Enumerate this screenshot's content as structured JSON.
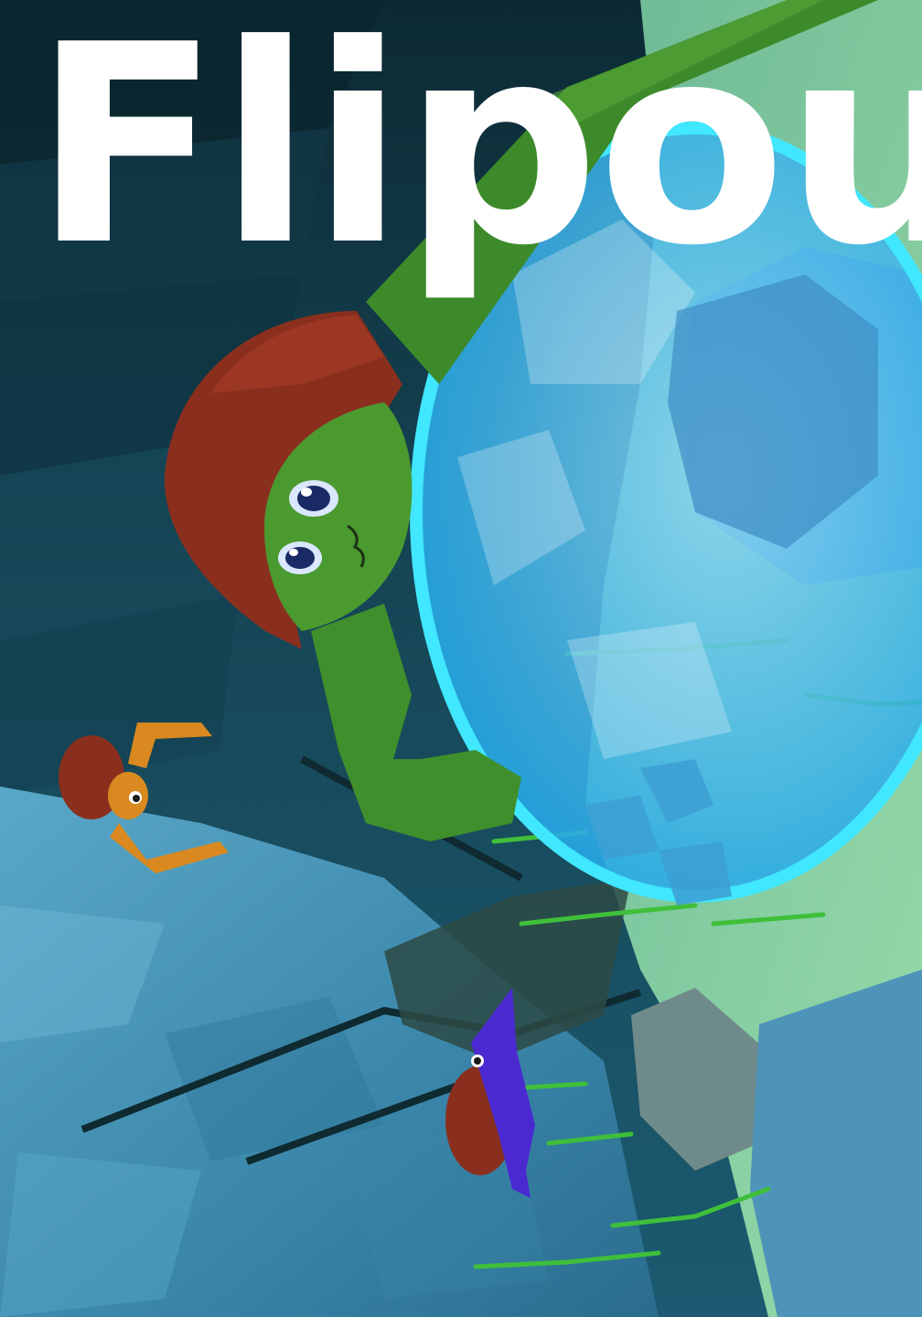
{
  "game": {
    "title": "Flipout"
  },
  "colors": {
    "cave_dark": "#0d2a33",
    "cave_mid": "#1d5466",
    "water_floor": "#4f9cbf",
    "bubble": "#2fb6f0",
    "bubble_rim": "#41e6ff",
    "turtle_skin": "#3f8f2c",
    "shell": "#8a2f1e",
    "orange_turtle": "#d9891f",
    "purple_turtle": "#4a2ad0",
    "seaweed": "#3fbf3a",
    "title_text": "#ffffff"
  },
  "characters": [
    {
      "id": "green-turtle",
      "color_name": "green"
    },
    {
      "id": "orange-turtle",
      "color_name": "orange"
    },
    {
      "id": "purple-turtle",
      "color_name": "purple"
    }
  ]
}
